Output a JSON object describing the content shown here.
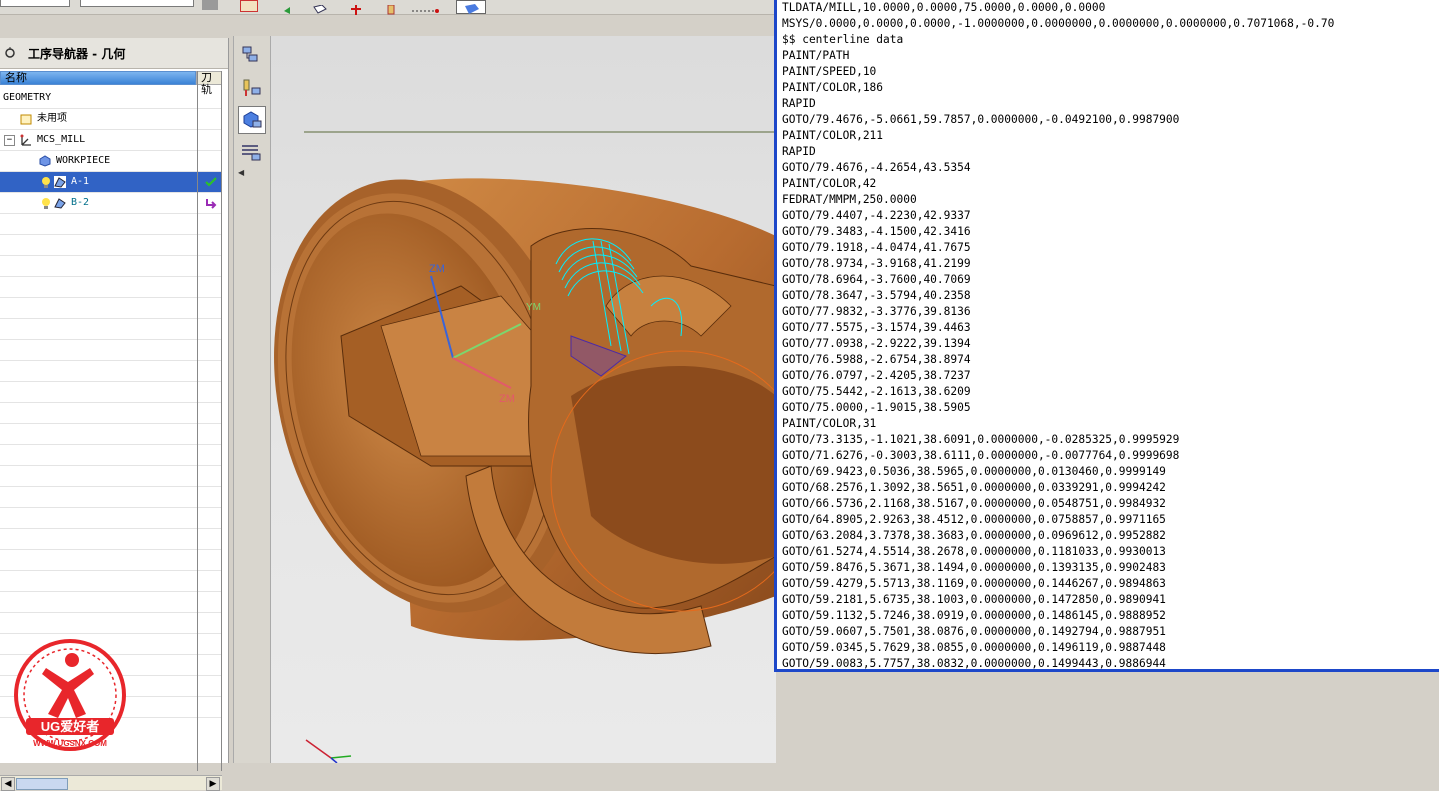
{
  "navigator": {
    "title": "工序导航器 - 几何",
    "columns": {
      "name": "名称",
      "tool": "刀轨"
    },
    "rows": [
      {
        "label": "GEOMETRY",
        "level": 0
      },
      {
        "label": "未用项",
        "level": 1
      },
      {
        "label": "MCS_MILL",
        "level": 1
      },
      {
        "label": "WORKPIECE",
        "level": 2
      },
      {
        "label": "A-1",
        "level": 3,
        "selected": true,
        "status": "check-icon"
      },
      {
        "label": "B-2",
        "level": 3,
        "status": "regenerate-arrow-icon"
      }
    ]
  },
  "viewport": {
    "axis_labels": {
      "zm_top": "ZM",
      "ym": "YM",
      "zm_bottom": "ZM"
    },
    "part_color": "#c0773a",
    "toolpath_color": "#00ffff"
  },
  "listing": {
    "lines": [
      "TLDATA/MILL,10.0000,0.0000,75.0000,0.0000,0.0000",
      "MSYS/0.0000,0.0000,0.0000,-1.0000000,0.0000000,0.0000000,0.0000000,0.7071068,-0.70",
      "$$ centerline data",
      "PAINT/PATH",
      "PAINT/SPEED,10",
      "PAINT/COLOR,186",
      "RAPID",
      "GOTO/79.4676,-5.0661,59.7857,0.0000000,-0.0492100,0.9987900",
      "PAINT/COLOR,211",
      "RAPID",
      "GOTO/79.4676,-4.2654,43.5354",
      "PAINT/COLOR,42",
      "FEDRAT/MMPM,250.0000",
      "GOTO/79.4407,-4.2230,42.9337",
      "GOTO/79.3483,-4.1500,42.3416",
      "GOTO/79.1918,-4.0474,41.7675",
      "GOTO/78.9734,-3.9168,41.2199",
      "GOTO/78.6964,-3.7600,40.7069",
      "GOTO/78.3647,-3.5794,40.2358",
      "GOTO/77.9832,-3.3776,39.8136",
      "GOTO/77.5575,-3.1574,39.4463",
      "GOTO/77.0938,-2.9222,39.1394",
      "GOTO/76.5988,-2.6754,38.8974",
      "GOTO/76.0797,-2.4205,38.7237",
      "GOTO/75.5442,-2.1613,38.6209",
      "GOTO/75.0000,-1.9015,38.5905",
      "PAINT/COLOR,31",
      "GOTO/73.3135,-1.1021,38.6091,0.0000000,-0.0285325,0.9995929",
      "GOTO/71.6276,-0.3003,38.6111,0.0000000,-0.0077764,0.9999698",
      "GOTO/69.9423,0.5036,38.5965,0.0000000,0.0130460,0.9999149",
      "GOTO/68.2576,1.3092,38.5651,0.0000000,0.0339291,0.9994242",
      "GOTO/66.5736,2.1168,38.5167,0.0000000,0.0548751,0.9984932",
      "GOTO/64.8905,2.9263,38.4512,0.0000000,0.0758857,0.9971165",
      "GOTO/63.2084,3.7378,38.3683,0.0000000,0.0969612,0.9952882",
      "GOTO/61.5274,4.5514,38.2678,0.0000000,0.1181033,0.9930013",
      "GOTO/59.8476,5.3671,38.1494,0.0000000,0.1393135,0.9902483",
      "GOTO/59.4279,5.5713,38.1169,0.0000000,0.1446267,0.9894863",
      "GOTO/59.2181,5.6735,38.1003,0.0000000,0.1472850,0.9890941",
      "GOTO/59.1132,5.7246,38.0919,0.0000000,0.1486145,0.9888952",
      "GOTO/59.0607,5.7501,38.0876,0.0000000,0.1492794,0.9887951",
      "GOTO/59.0345,5.7629,38.0855,0.0000000,0.1496119,0.9887448",
      "GOTO/59.0083,5.7757,38.0832,0.0000000,0.1499443,0.9886944"
    ]
  },
  "watermark": {
    "brand": "UG爱好者",
    "url": "WWW.UGSNX.COM"
  }
}
